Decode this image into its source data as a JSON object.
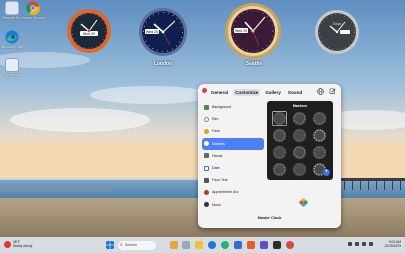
{
  "desktop": {
    "icons": [
      {
        "label": "Recycle Bin",
        "icon": "recycle-bin-icon"
      },
      {
        "label": "Google Chrome",
        "icon": "chrome-icon"
      },
      {
        "label": "Microsoft Edge",
        "icon": "edge-icon"
      },
      {
        "label": "Screenshot",
        "icon": "screenshot-icon"
      }
    ]
  },
  "clocks": [
    {
      "caption": "",
      "date_badge": "Mon 25",
      "frame_color": "#e0662a",
      "time": "10:10"
    },
    {
      "caption": "London",
      "date_badge": "Wed 25",
      "frame_color": "#6f7fa8",
      "time": "10:10"
    },
    {
      "caption": "Seattle",
      "date_badge": "Wed 25",
      "frame_color": "#c9a35b",
      "time": "10:10"
    },
    {
      "caption": "",
      "date_badge": "Tokyo",
      "frame_color": "#c7c9cc",
      "time": "10:10"
    }
  ],
  "panel": {
    "tabs": [
      {
        "label": "General",
        "active": false
      },
      {
        "label": "Customize",
        "active": true
      },
      {
        "label": "Gallery",
        "active": false
      },
      {
        "label": "Sound",
        "active": false
      }
    ],
    "sidebar": [
      {
        "label": "Background",
        "color": "#4c8c4a",
        "active": false
      },
      {
        "label": "Rim",
        "color": "#888888",
        "active": false
      },
      {
        "label": "Face",
        "color": "#e0a020",
        "active": false
      },
      {
        "label": "Markers",
        "color": "#ffffff",
        "active": true
      },
      {
        "label": "Hands",
        "color": "#666666",
        "active": false
      },
      {
        "label": "Date",
        "color": "#3b6cf6",
        "active": false
      },
      {
        "label": "Face Text",
        "color": "#555555",
        "active": false
      },
      {
        "label": "Appointment Arc",
        "color": "#c0392b",
        "active": false
      },
      {
        "label": "Moon",
        "color": "#333333",
        "active": false
      }
    ],
    "markers_title": "Markers",
    "marker_count": 12,
    "selected_marker": 0,
    "footer": "Master Clock",
    "accent": "#4f7ef7"
  },
  "taskbar": {
    "weather_temp": "48°F",
    "weather_desc": "Mostly cloudy",
    "search_placeholder": "Search",
    "time": "9:02 AM",
    "date": "10/25/2023"
  }
}
